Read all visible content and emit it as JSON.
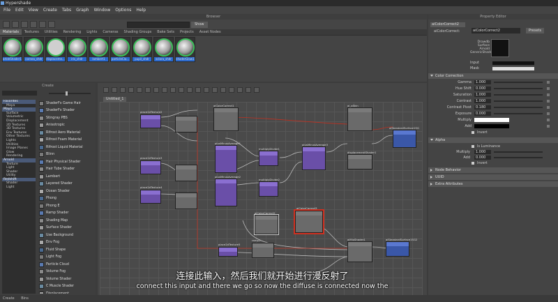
{
  "window": {
    "title": "Hypershade"
  },
  "menu": [
    "File",
    "Edit",
    "View",
    "Create",
    "Tabs",
    "Graph",
    "Window",
    "Options",
    "Help"
  ],
  "browser": {
    "title": "Browser",
    "show_label": "Show",
    "tabs": [
      "Materials",
      "Textures",
      "Utilities",
      "Rendering",
      "Lights",
      "Cameras",
      "Shading Groups",
      "Bake Sets",
      "Projects",
      "Asset Nodes"
    ],
    "swatches": [
      "arbleShader1",
      "cornea_shdr",
      "displaceme...",
      "iris_shdr",
      "lambert1",
      "particleClo...",
      "pupil_shdr",
      "sclara_shdr",
      "shaderGlow1"
    ]
  },
  "create": {
    "title": "Create",
    "tree": [
      {
        "label": "Favorites",
        "kind": "cat"
      },
      {
        "label": "Maya",
        "kind": "sub"
      },
      {
        "label": "Maya",
        "kind": "cat"
      },
      {
        "label": "Surface",
        "kind": "sub"
      },
      {
        "label": "Volumetric",
        "kind": "sub"
      },
      {
        "label": "Displacement",
        "kind": "sub"
      },
      {
        "label": "2D Textures",
        "kind": "sub"
      },
      {
        "label": "3D Textures",
        "kind": "sub"
      },
      {
        "label": "Env Textures",
        "kind": "sub"
      },
      {
        "label": "Other Textures",
        "kind": "sub"
      },
      {
        "label": "Lights",
        "kind": "sub"
      },
      {
        "label": "Utilities",
        "kind": "sub"
      },
      {
        "label": "Image Planes",
        "kind": "sub"
      },
      {
        "label": "Glow",
        "kind": "sub"
      },
      {
        "label": "Rendering",
        "kind": "sub"
      },
      {
        "label": "Arnold",
        "kind": "cat"
      },
      {
        "label": "Texture",
        "kind": "sub"
      },
      {
        "label": "Light",
        "kind": "sub"
      },
      {
        "label": "Shader",
        "kind": "sub"
      },
      {
        "label": "Utility",
        "kind": "sub"
      },
      {
        "label": "Redshift",
        "kind": "cat"
      },
      {
        "label": "Shader",
        "kind": "sub"
      },
      {
        "label": "Light",
        "kind": "sub"
      }
    ],
    "nodes": [
      "ShaderFx Game Hair",
      "ShaderFx Shader",
      "Stingray PBS",
      "Anisotropic",
      "Rifrost Aero Material",
      "Rifrost Foam Material",
      "Rifrost Liquid Material",
      "Blinn",
      "Hair Physical Shader",
      "Hair Tube Shader",
      "Lambert",
      "Layered Shader",
      "Ocean Shader",
      "Phong",
      "Phong E",
      "Ramp Shader",
      "Shading Map",
      "Surface Shader",
      "Use Background",
      "Env Fog",
      "Fluid Shape",
      "Light Fog",
      "Particle Cloud",
      "Volume Fog",
      "Volume Shader",
      "C Muscle Shader",
      "Displacement"
    ]
  },
  "graph": {
    "tab": "Untitled_1",
    "nodes": [
      "place2dTexture2",
      "place2dTexture3",
      "place2dTexture4",
      "aiColorCorrect1",
      "aiColorCorrect2",
      "multiplyDivide1",
      "multiplyDivide2",
      "plusMinusAverage1",
      "plusMinusAverage2",
      "plusMinusAverage3",
      "displacementShader1",
      "ai_aSkin",
      "aiStandardSurface1SG",
      "aiMixShader1",
      "aiStandardSurface1SG2",
      "ramp1",
      "place2dTexture5",
      "aiColorCorrect3"
    ]
  },
  "attribute_editor": {
    "title": "Property Editor",
    "node_label": "aiColorCorrect:",
    "node_value": "aiColorCorrect2",
    "presets": "Presets",
    "swatch_caption": [
      "Drawdb",
      "Surface",
      "Arnold",
      "GenericShader"
    ],
    "input_label": "Input",
    "mask_label": "Mask",
    "sections": {
      "color_correction": "Color Correction",
      "alpha": "Alpha",
      "node_behavior": "Node Behavior",
      "uuid": "UUID",
      "extra": "Extra Attributes"
    },
    "cc": [
      {
        "label": "Gamma",
        "value": "1.000"
      },
      {
        "label": "Hue Shift",
        "value": "0.000"
      },
      {
        "label": "Saturation",
        "value": "1.000"
      },
      {
        "label": "Contrast",
        "value": "1.000"
      },
      {
        "label": "Contrast Pivot",
        "value": "0.180"
      },
      {
        "label": "Exposure",
        "value": "0.000"
      },
      {
        "label": "Multiply",
        "value": ""
      },
      {
        "label": "Add",
        "value": ""
      }
    ],
    "invert": "Invert",
    "is_luminance": "Is Luminance",
    "alpha": [
      {
        "label": "Multiply",
        "value": "1.000"
      },
      {
        "label": "Add",
        "value": "0.000"
      }
    ]
  },
  "status": {
    "tabs": [
      "Create",
      "Bins"
    ]
  },
  "subtitles": {
    "cn": "连接此输入，然后我们就开始进行漫反射了",
    "en": "connect this input and there we go so now the diffuse is connected now the"
  }
}
